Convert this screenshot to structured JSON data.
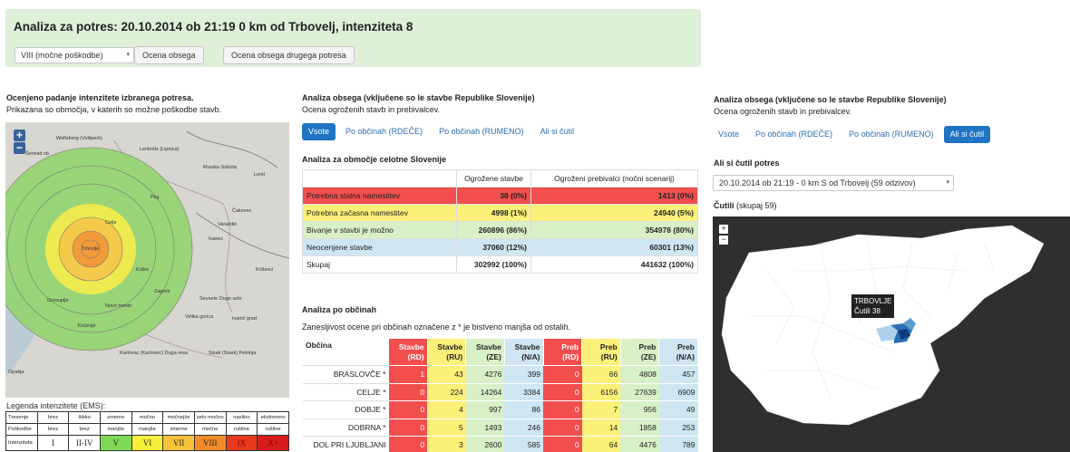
{
  "banner": {
    "title": "Analiza za potres: 20.10.2014 ob 21:19 0 km od Trbovelj, intenziteta 8",
    "select_value": "VIII (močne poškodbe)",
    "btn_ocena": "Ocena obsega",
    "btn_ocena_drugega": "Ocena obsega drugega potresa"
  },
  "intensity": {
    "title": "Ocenjeno padanje intenzitete izbranega potresa.",
    "subtitle": "Prikazana so območja, v katerih so možne poškodbe stavb.",
    "zoom_in": "+",
    "zoom_out": "−",
    "labels": [
      "Wolfsberg (Voltiperk)",
      "Lenbnitz (Lipnica)",
      "Murska Sobota",
      "Lenti",
      "Čakovec",
      "Varaždin",
      "Ivanec",
      "Križevci",
      "Sevnete Dugo selo",
      "Velika gorica",
      "Ivanić grad",
      "Karlovac (Karlovec) Duga resa",
      "Sisak (Sisek) Petrinja",
      "Opatija",
      "Krško",
      "Celje",
      "Novo mesto",
      "Kočevje",
      "Grosuplje",
      "Trbovlje",
      "Šentvid ob",
      "Ptuj",
      "Zagreb"
    ],
    "legend_title": "Legenda intenzitete (EMS):",
    "legend": {
      "rows": [
        {
          "head": "Tresenje",
          "cells": [
            "brez",
            "šibko",
            "zmerno",
            "močno",
            "močnejše",
            "zelo močno",
            "nasilno",
            "ekstremno"
          ]
        },
        {
          "head": "Poškodbe",
          "cells": [
            "brez",
            "brez",
            "manjše",
            "manjše",
            "zmerne",
            "močne",
            "rušilne",
            "rušilne"
          ]
        },
        {
          "head": "Intenziteta",
          "cells": [
            "I",
            "II-IV",
            "V",
            "VI",
            "VII",
            "VIII",
            "IX",
            "X+"
          ]
        }
      ],
      "colors": [
        "#ffffff",
        "#ffffff",
        "#7ed957",
        "#f7ef3a",
        "#f7c23a",
        "#f28c28",
        "#e53a1e",
        "#d81b1b"
      ]
    }
  },
  "analysis": {
    "title": "Analiza obsega (vključene so le stavbe Republike Slovenije)",
    "subtitle": "Ocena ogroženih stavb in prebivalcev.",
    "tabs": [
      "Vsote",
      "Po občinah (RDEČE)",
      "Po občinah (RUMENO)",
      "Ali si čutil"
    ],
    "active_tab": 0,
    "area_title": "Analiza za območje celotne Slovenije",
    "sum_headers": [
      "",
      "Ogrožene stavbe",
      "Ogroženi prebivalci (nočni scenarij)"
    ],
    "sum_rows": [
      {
        "label": "Potrebna stalna namestitev",
        "stavbe": "38 (0%)",
        "preb": "1413 (0%)",
        "color": "red"
      },
      {
        "label": "Potrebna začasna namestitev",
        "stavbe": "4998 (1%)",
        "preb": "24940 (5%)",
        "color": "yel"
      },
      {
        "label": "Bivanje v stavbi je možno",
        "stavbe": "260896 (86%)",
        "preb": "354978 (80%)",
        "color": "grn"
      },
      {
        "label": "Neocenjene stavbe",
        "stavbe": "37060 (12%)",
        "preb": "60301 (13%)",
        "color": "blu"
      },
      {
        "label": "Skupaj",
        "stavbe": "302992 (100%)",
        "preb": "441632 (100%)",
        "color": ""
      }
    ],
    "obc_title": "Analiza po občinah",
    "obc_note": "Zanesljivost ocene pri občinah označene z * je bistveno manjša od ostalih.",
    "obc_headers": [
      "Občina",
      "Stavbe (RD)",
      "Stavbe (RU)",
      "Stavbe (ZE)",
      "Stavbe (N/A)",
      "Preb (RD)",
      "Preb (RU)",
      "Preb (ZE)",
      "Preb (N/A)"
    ],
    "obc_rows": [
      [
        "BRASLOVČE *",
        "1",
        "43",
        "4276",
        "399",
        "0",
        "66",
        "4808",
        "457"
      ],
      [
        "CELJE *",
        "0",
        "224",
        "14264",
        "3384",
        "0",
        "6156",
        "27639",
        "6909"
      ],
      [
        "DOBJE *",
        "0",
        "4",
        "997",
        "86",
        "0",
        "7",
        "956",
        "49"
      ],
      [
        "DOBRNA *",
        "0",
        "5",
        "1493",
        "246",
        "0",
        "14",
        "1858",
        "253"
      ],
      [
        "DOL PRI LJUBLJANI",
        "0",
        "3",
        "2600",
        "585",
        "0",
        "64",
        "4476",
        "789"
      ]
    ]
  },
  "felt": {
    "title": "Analiza obsega (vključene so le stavbe Republike Slovenije)",
    "subtitle": "Ocena ogroženih stavb in prebivalcev.",
    "tabs": [
      "Vsote",
      "Po občinah (RDEČE)",
      "Po občinah (RUMENO)",
      "Ali si čutil"
    ],
    "active_tab": 3,
    "question": "Ali si čutil potres",
    "select_value": "20.10.2014 ob 21:19 - 0 km S od Trbovelj (59 odzivov)",
    "felt_label": "Čutili",
    "felt_total": "(skupaj 59)",
    "zoom_in": "+",
    "zoom_out": "−",
    "tooltip_name": "TRBOVLJE",
    "tooltip_value": "Čutili 38"
  }
}
